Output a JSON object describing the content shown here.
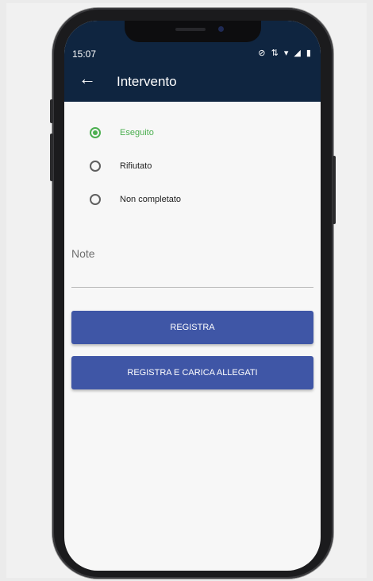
{
  "status": {
    "time": "15:07",
    "icons": "⊘ ⇅ ▾ ◢ ▮"
  },
  "appbar": {
    "back_icon": "←",
    "title": "Intervento"
  },
  "options": [
    {
      "label": "Eseguito",
      "selected": true
    },
    {
      "label": "Rifiutato",
      "selected": false
    },
    {
      "label": "Non completato",
      "selected": false
    }
  ],
  "note": {
    "label": "Note",
    "value": ""
  },
  "buttons": {
    "register": "REGISTRA",
    "register_attach": "REGISTRA E CARICA ALLEGATI"
  },
  "colors": {
    "appbar": "#0f2540",
    "accent_green": "#4caf50",
    "button": "#3f56a6"
  }
}
